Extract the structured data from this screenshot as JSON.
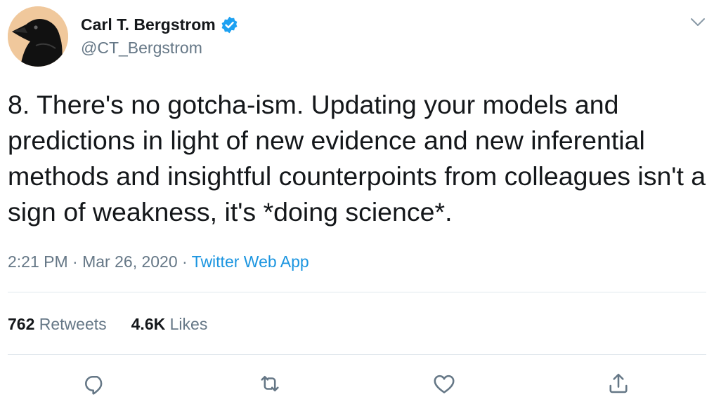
{
  "author": {
    "name": "Carl T. Bergstrom",
    "handle": "@CT_Bergstrom",
    "verified": true
  },
  "tweet": {
    "text": "8. There's no gotcha-ism. Updating your models and predictions in light of new evidence and new inferential methods and insightful counterpoints from colleagues isn't a sign of weakness, it's *doing science*.",
    "time": "2:21 PM",
    "separator": "·",
    "date": "Mar 26, 2020",
    "source": "Twitter Web App"
  },
  "stats": {
    "retweets_count": "762",
    "retweets_label": "Retweets",
    "likes_count": "4.6K",
    "likes_label": "Likes"
  },
  "actions": {
    "reply_icon": "reply-icon",
    "retweet_icon": "retweet-icon",
    "like_icon": "heart-icon",
    "share_icon": "share-icon"
  },
  "colors": {
    "text_primary": "#14171a",
    "text_secondary": "#657786",
    "link": "#1b95e0",
    "verified": "#1da1f2",
    "divider": "#e1e8ed"
  }
}
